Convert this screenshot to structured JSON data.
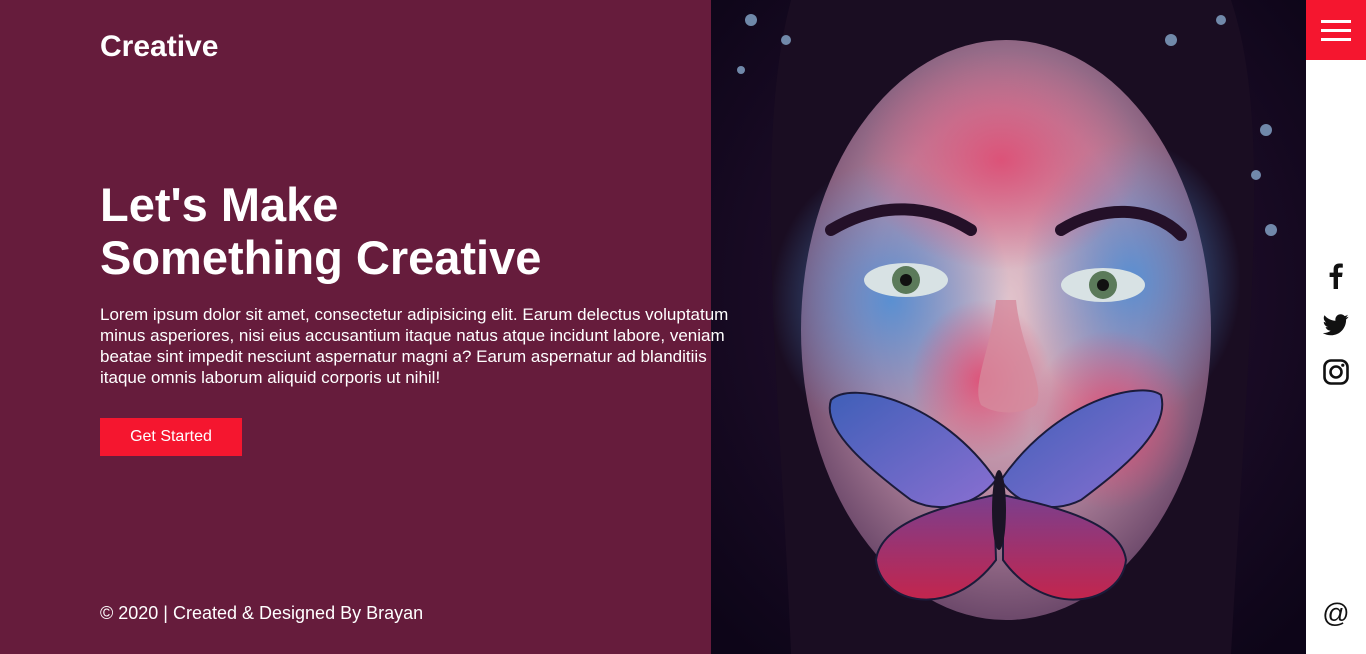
{
  "brand": {
    "logo": "Creative"
  },
  "hero": {
    "headline_line1": "Let's Make",
    "headline_line2": "Something Creative",
    "description": "Lorem ipsum dolor sit amet, consectetur adipisicing elit. Earum delectus voluptatum minus asperiores, nisi eius accusantium itaque natus atque incidunt labore, veniam beatae sint impedit nesciunt aspernatur magni a? Earum aspernatur ad blanditiis itaque omnis laborum aliquid corporis ut nihil!",
    "cta_label": "Get Started"
  },
  "footer": {
    "copyright": "© 2020 | Created & Designed By Brayan"
  },
  "sidebar": {
    "menu_icon": "hamburger-menu-icon",
    "social": [
      "facebook-icon",
      "twitter-icon",
      "instagram-icon"
    ],
    "contact_glyph": "@"
  },
  "colors": {
    "left_panel": "#661c3c",
    "accent": "#f5162f",
    "rail": "#ffffff",
    "text": "#ffffff"
  }
}
